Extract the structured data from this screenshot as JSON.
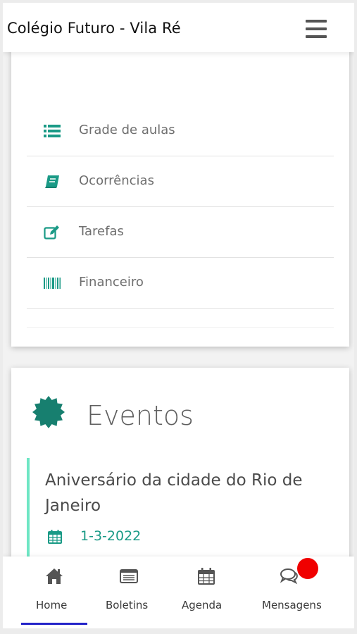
{
  "app": {
    "title": "Colégio Futuro - Vila Ré",
    "menu_icon": "hamburger-icon"
  },
  "menu": {
    "items": [
      {
        "label": "Grade de aulas",
        "icon": "list-icon"
      },
      {
        "label": "Ocorrências",
        "icon": "book-icon"
      },
      {
        "label": "Tarefas",
        "icon": "edit-icon"
      },
      {
        "label": "Financeiro",
        "icon": "barcode-icon"
      }
    ]
  },
  "events": {
    "heading": "Eventos",
    "icon": "badge-icon",
    "items": [
      {
        "name": "Aniversário da cidade do Rio de Janeiro",
        "date": "1-3-2022",
        "date_icon": "calendar-icon"
      }
    ]
  },
  "bottom_nav": {
    "items": [
      {
        "label": "Home",
        "icon": "home-icon",
        "active": true
      },
      {
        "label": "Boletins",
        "icon": "report-card-icon",
        "active": false
      },
      {
        "label": "Agenda",
        "icon": "calendar-icon",
        "active": false
      },
      {
        "label": "Mensagens",
        "icon": "chat-icon",
        "active": false
      }
    ]
  },
  "colors": {
    "accent": "#1a9a86",
    "event_bar": "#6ee6c4",
    "active_underline": "#2424c9",
    "notification_badge": "#f00000"
  }
}
